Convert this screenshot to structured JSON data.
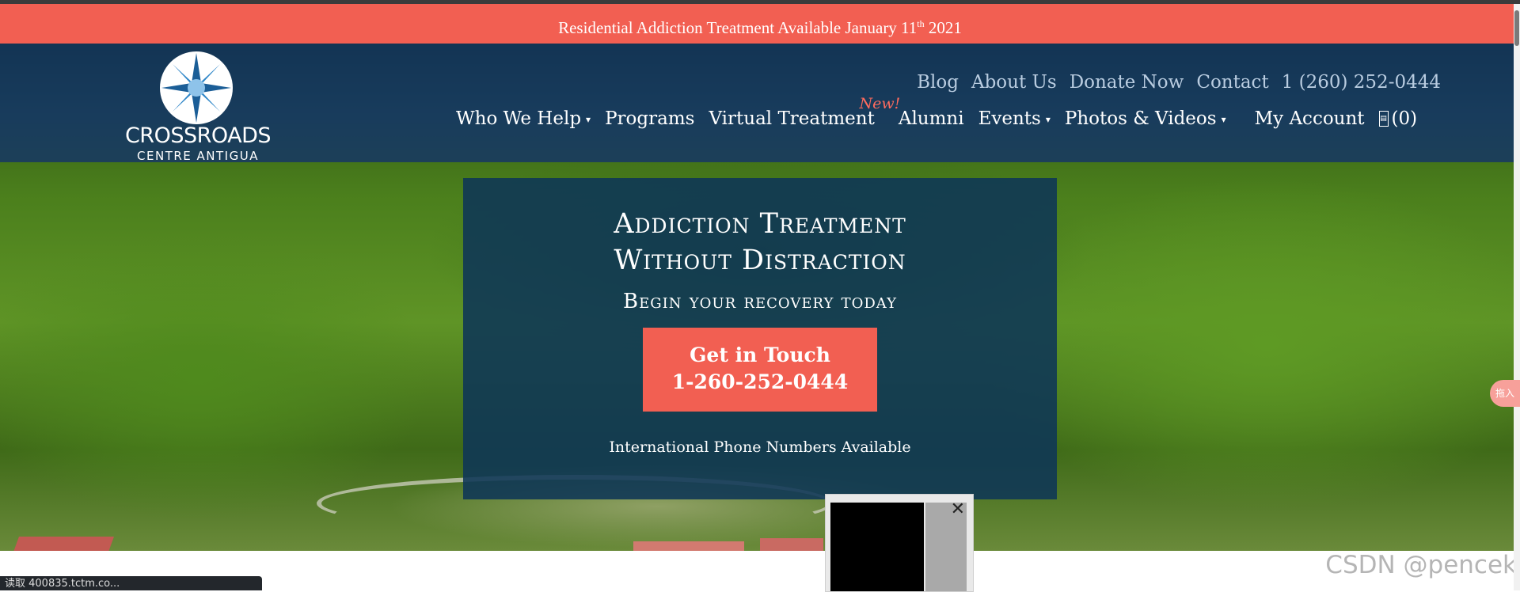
{
  "announcement": {
    "text": "Residential Addiction Treatment Available January 11",
    "sup": "th",
    "year": " 2021"
  },
  "brand": {
    "name": "CROSSROADS",
    "subtitle": "CENTRE ANTIGUA"
  },
  "utility_nav": [
    {
      "label": "Blog"
    },
    {
      "label": "About Us"
    },
    {
      "label": "Donate Now"
    },
    {
      "label": "Contact"
    },
    {
      "label": "1 (260) 252-0444"
    }
  ],
  "main_nav": [
    {
      "label": "Who We Help",
      "has_dropdown": true
    },
    {
      "label": "Programs",
      "has_dropdown": false
    },
    {
      "label": "Virtual Treatment",
      "has_dropdown": false,
      "badge": "New!"
    },
    {
      "label": "Alumni",
      "has_dropdown": false
    },
    {
      "label": "Events",
      "has_dropdown": true
    },
    {
      "label": "Photos & Videos",
      "has_dropdown": true
    },
    {
      "label": "My Account",
      "has_dropdown": false
    }
  ],
  "cart": {
    "count": "(0)",
    "icon": "cart-icon"
  },
  "hero": {
    "headline_line1": "Addiction Treatment",
    "headline_line2": "Without Distraction",
    "subheadline": "Begin your recovery today",
    "cta_line1": "Get in Touch",
    "cta_line2": "1-260-252-0444",
    "footnote": "International Phone Numbers Available"
  },
  "status_bar": {
    "text": "读取 400835.tctm.co..."
  },
  "watermark": {
    "text": "CSDN @pencek"
  },
  "side_badge": {
    "text": "拖入"
  },
  "colors": {
    "accent": "#f25f52",
    "header_bg": "#143758",
    "panel_bg": "#0e3656"
  }
}
